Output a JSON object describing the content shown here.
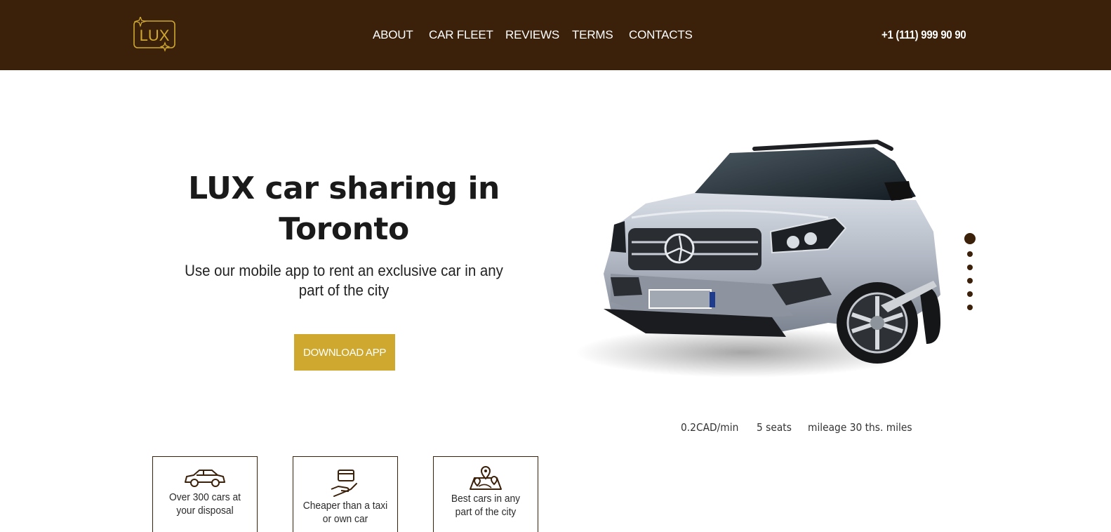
{
  "brand": {
    "logo_text": "LUX",
    "accent_color": "#cfa92f",
    "header_color": "#3b200a"
  },
  "nav": {
    "items": [
      {
        "label": "ABOUT"
      },
      {
        "label": "CAR FLEET"
      },
      {
        "label": "REVIEWS"
      },
      {
        "label": "TERMS"
      },
      {
        "label": "CONTACTS"
      }
    ],
    "phone": "+1 (111) 999 90 90"
  },
  "hero": {
    "title_line1": "LUX car sharing in",
    "title_line2": "Toronto",
    "subtitle_line1": "Use our mobile app to rent an exclusive car in any",
    "subtitle_line2": "part of the city",
    "button_label": "DOWNLOAD APP"
  },
  "car": {
    "price": "0.2CAD/min",
    "seats": "5 seats",
    "mileage": "mileage 30 ths. miles",
    "slider_count": 6,
    "active_slide": 1
  },
  "features": [
    {
      "line1": "Over 300 cars at",
      "line2": "your disposal",
      "icon": "car-icon"
    },
    {
      "line1": "Cheaper than a taxi",
      "line2": "or own car",
      "icon": "card-in-hand-icon"
    },
    {
      "line1": "Best cars in any",
      "line2": "part of the city",
      "icon": "map-pins-icon"
    }
  ]
}
